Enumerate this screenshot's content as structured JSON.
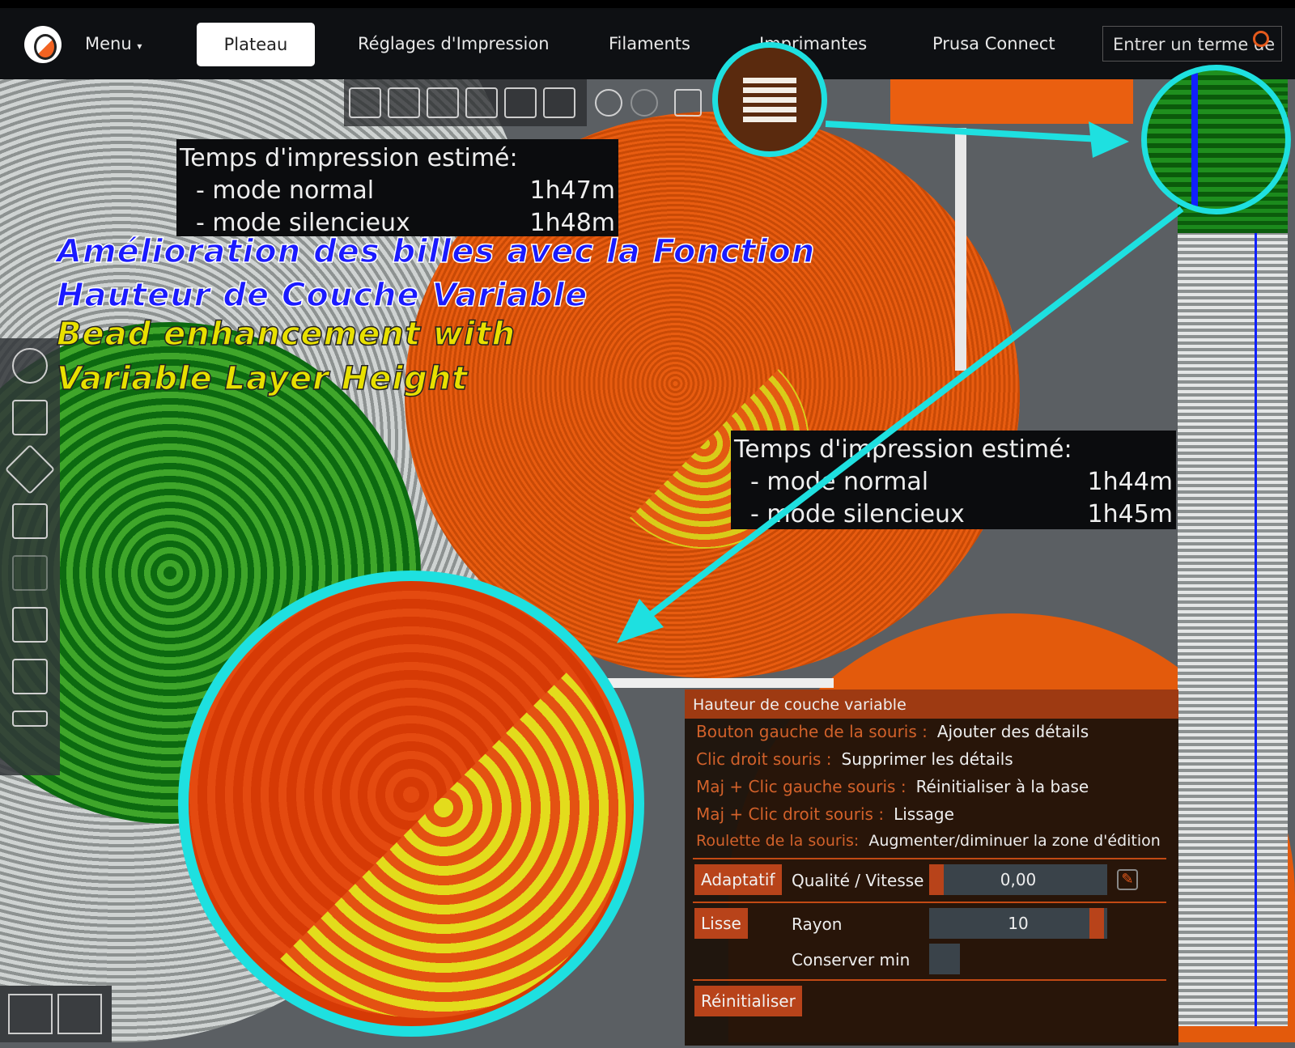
{
  "header": {
    "menu": "Menu",
    "tabs": [
      "Plateau",
      "Réglages d'Impression",
      "Filaments",
      "Imprimantes",
      "Prusa Connect"
    ],
    "active_tab": "Plateau",
    "search_placeholder": "Entrer un terme de recherche"
  },
  "time_box_1": {
    "title": "Temps d'impression estimé:",
    "normal_label": "- mode normal",
    "normal_value": "1h47m",
    "silent_label": "- mode silencieux",
    "silent_value": "1h48m"
  },
  "time_box_2": {
    "title": "Temps d'impression estimé:",
    "normal_label": "- mode normal",
    "normal_value": "1h44m",
    "silent_label": "- mode silencieux",
    "silent_value": "1h45m"
  },
  "overlay": {
    "fr_line1": "Amélioration des billes avec la Fonction",
    "fr_line2": "Hauteur de Couche Variable",
    "en_line1": "Bead enhancement with",
    "en_line2": "Variable Layer Height"
  },
  "panel": {
    "title": "Hauteur de couche variable",
    "hints": [
      {
        "key": "Bouton gauche de la souris :",
        "action": "Ajouter des détails"
      },
      {
        "key": "Clic droit souris :",
        "action": "Supprimer les détails"
      },
      {
        "key": "Maj + Clic gauche souris :",
        "action": "Réinitialiser à la base"
      },
      {
        "key": "Maj + Clic droit souris :",
        "action": "Lissage"
      },
      {
        "key": "Roulette de la souris:",
        "action": "Augmenter/diminuer la zone d'édition"
      }
    ],
    "adaptive_button": "Adaptatif",
    "quality_label": "Qualité / Vitesse",
    "quality_value": "0,00",
    "smooth_button": "Lisse",
    "radius_label": "Rayon",
    "radius_value": "10",
    "keep_min_label": "Conserver min",
    "reset_button": "Réinitialiser"
  },
  "colors": {
    "accent": "#b8431a",
    "callout": "#1ee0e0",
    "header": "#0e1013"
  }
}
